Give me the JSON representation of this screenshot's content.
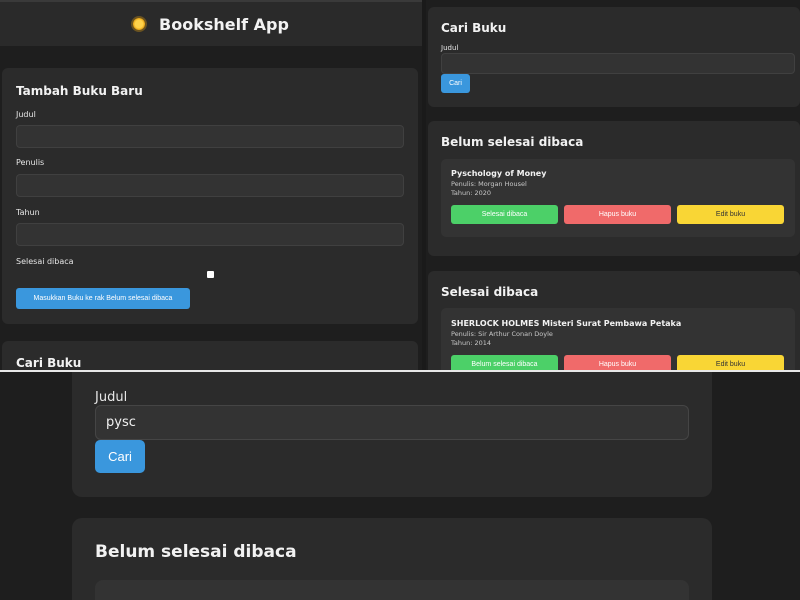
{
  "app": {
    "title": "Bookshelf App",
    "logo_icon": "sun-icon"
  },
  "add_form": {
    "title": "Tambah Buku Baru",
    "title_label": "Judul",
    "author_label": "Penulis",
    "year_label": "Tahun",
    "finished_label": "Selesai dibaca",
    "submit_label": "Masukkan Buku ke rak Belum selesai dibaca",
    "title_value": "",
    "author_value": "",
    "year_value": ""
  },
  "search_left": {
    "title": "Cari Buku"
  },
  "search": {
    "title": "Cari Buku",
    "label": "Judul",
    "value": "",
    "button_label": "Cari"
  },
  "unread": {
    "title": "Belum selesai dibaca",
    "books": [
      {
        "title": "Pyschology of Money",
        "author": "Penulis: Morgan Housel",
        "year": "Tahun: 2020",
        "move_label": "Selesai dibaca",
        "delete_label": "Hapus buku",
        "edit_label": "Edit buku"
      }
    ]
  },
  "read": {
    "title": "Selesai dibaca",
    "books": [
      {
        "title": "SHERLOCK HOLMES Misteri Surat Pembawa Petaka",
        "author": "Penulis: Sir Arthur Conan Doyle",
        "year": "Tahun: 2014",
        "move_label": "Belum selesai dibaca",
        "delete_label": "Hapus buku",
        "edit_label": "Edit buku"
      }
    ]
  },
  "zoom": {
    "search_label": "Judul",
    "search_value": "pysc",
    "button_label": "Cari",
    "unread_title": "Belum selesai dibaca"
  },
  "colors": {
    "accent_blue": "#3a97dd",
    "green": "#4cd068",
    "red": "#f06a6a",
    "yellow": "#f9d635"
  }
}
